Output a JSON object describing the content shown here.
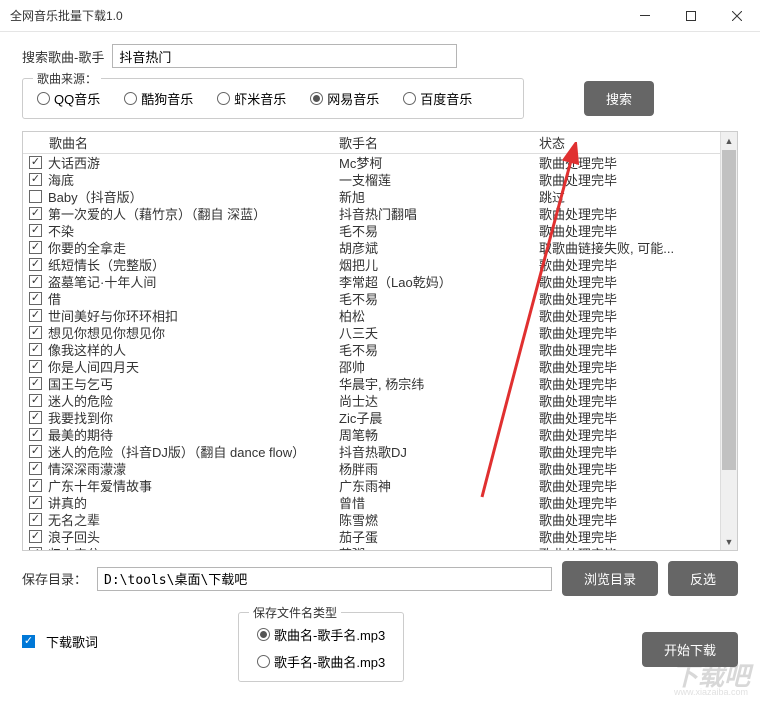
{
  "window": {
    "title": "全网音乐批量下载1.0"
  },
  "search": {
    "label": "搜索歌曲-歌手",
    "value": "抖音热门",
    "button": "搜索"
  },
  "sources": {
    "legend": "歌曲来源：",
    "options": [
      "QQ音乐",
      "酷狗音乐",
      "虾米音乐",
      "网易音乐",
      "百度音乐"
    ],
    "selected": 3
  },
  "table": {
    "headers": {
      "song": "歌曲名",
      "artist": "歌手名",
      "status": "状态"
    },
    "rows": [
      {
        "checked": true,
        "song": "大话西游",
        "artist": "Mc梦柯",
        "status": "歌曲处理完毕"
      },
      {
        "checked": true,
        "song": "海底",
        "artist": "一支榴莲",
        "status": "歌曲处理完毕"
      },
      {
        "checked": false,
        "song": "Baby（抖音版）",
        "artist": "新旭",
        "status": "跳过"
      },
      {
        "checked": true,
        "song": "第一次爱的人（藉竹京）（翻自 深蓝）",
        "artist": "抖音热门翻唱",
        "status": "歌曲处理完毕"
      },
      {
        "checked": true,
        "song": "不染",
        "artist": "毛不易",
        "status": "歌曲处理完毕"
      },
      {
        "checked": true,
        "song": "你要的全拿走",
        "artist": "胡彦斌",
        "status": "取歌曲链接失败, 可能..."
      },
      {
        "checked": true,
        "song": "纸短情长（完整版）",
        "artist": "烟把儿",
        "status": "歌曲处理完毕"
      },
      {
        "checked": true,
        "song": "盗墓笔记·十年人间",
        "artist": "李常超（Lao乾妈）",
        "status": "歌曲处理完毕"
      },
      {
        "checked": true,
        "song": "借",
        "artist": "毛不易",
        "status": "歌曲处理完毕"
      },
      {
        "checked": true,
        "song": "世间美好与你环环相扣",
        "artist": "柏松",
        "status": "歌曲处理完毕"
      },
      {
        "checked": true,
        "song": "想见你想见你想见你",
        "artist": "八三夭",
        "status": "歌曲处理完毕"
      },
      {
        "checked": true,
        "song": "像我这样的人",
        "artist": "毛不易",
        "status": "歌曲处理完毕"
      },
      {
        "checked": true,
        "song": "你是人间四月天",
        "artist": "邵帅",
        "status": "歌曲处理完毕"
      },
      {
        "checked": true,
        "song": "国王与乞丐",
        "artist": "华晨宇, 杨宗纬",
        "status": "歌曲处理完毕"
      },
      {
        "checked": true,
        "song": "迷人的危险",
        "artist": "尚士达",
        "status": "歌曲处理完毕"
      },
      {
        "checked": true,
        "song": "我要找到你",
        "artist": "Zic子晨",
        "status": "歌曲处理完毕"
      },
      {
        "checked": true,
        "song": "最美的期待",
        "artist": "周笔畅",
        "status": "歌曲处理完毕"
      },
      {
        "checked": true,
        "song": "迷人的危险（抖音DJ版）（翻自 dance flow）",
        "artist": "抖音热歌DJ",
        "status": "歌曲处理完毕"
      },
      {
        "checked": true,
        "song": "情深深雨濛濛",
        "artist": "杨胖雨",
        "status": "歌曲处理完毕"
      },
      {
        "checked": true,
        "song": "广东十年爱情故事",
        "artist": "广东雨神",
        "status": "歌曲处理完毕"
      },
      {
        "checked": true,
        "song": "讲真的",
        "artist": "曾惜",
        "status": "歌曲处理完毕"
      },
      {
        "checked": true,
        "song": "无名之辈",
        "artist": "陈雪燃",
        "status": "歌曲处理完毕"
      },
      {
        "checked": true,
        "song": "浪子回头",
        "artist": "茄子蛋",
        "status": "歌曲处理完毕"
      },
      {
        "checked": true,
        "song": "归去来兮",
        "artist": "花粥",
        "status": "歌曲处理完毕"
      }
    ]
  },
  "path": {
    "label": "保存目录：",
    "value": "D:\\tools\\桌面\\下载吧",
    "browse": "浏览目录",
    "invert": "反选"
  },
  "bottom": {
    "downloadLyric": "下载歌词",
    "nameGroup": {
      "legend": "保存文件名类型",
      "options": [
        "歌曲名-歌手名.mp3",
        "歌手名-歌曲名.mp3"
      ],
      "selected": 0
    },
    "start": "开始下载"
  },
  "watermark": {
    "main": "下载吧",
    "sub": "www.xiazaiba.com"
  }
}
